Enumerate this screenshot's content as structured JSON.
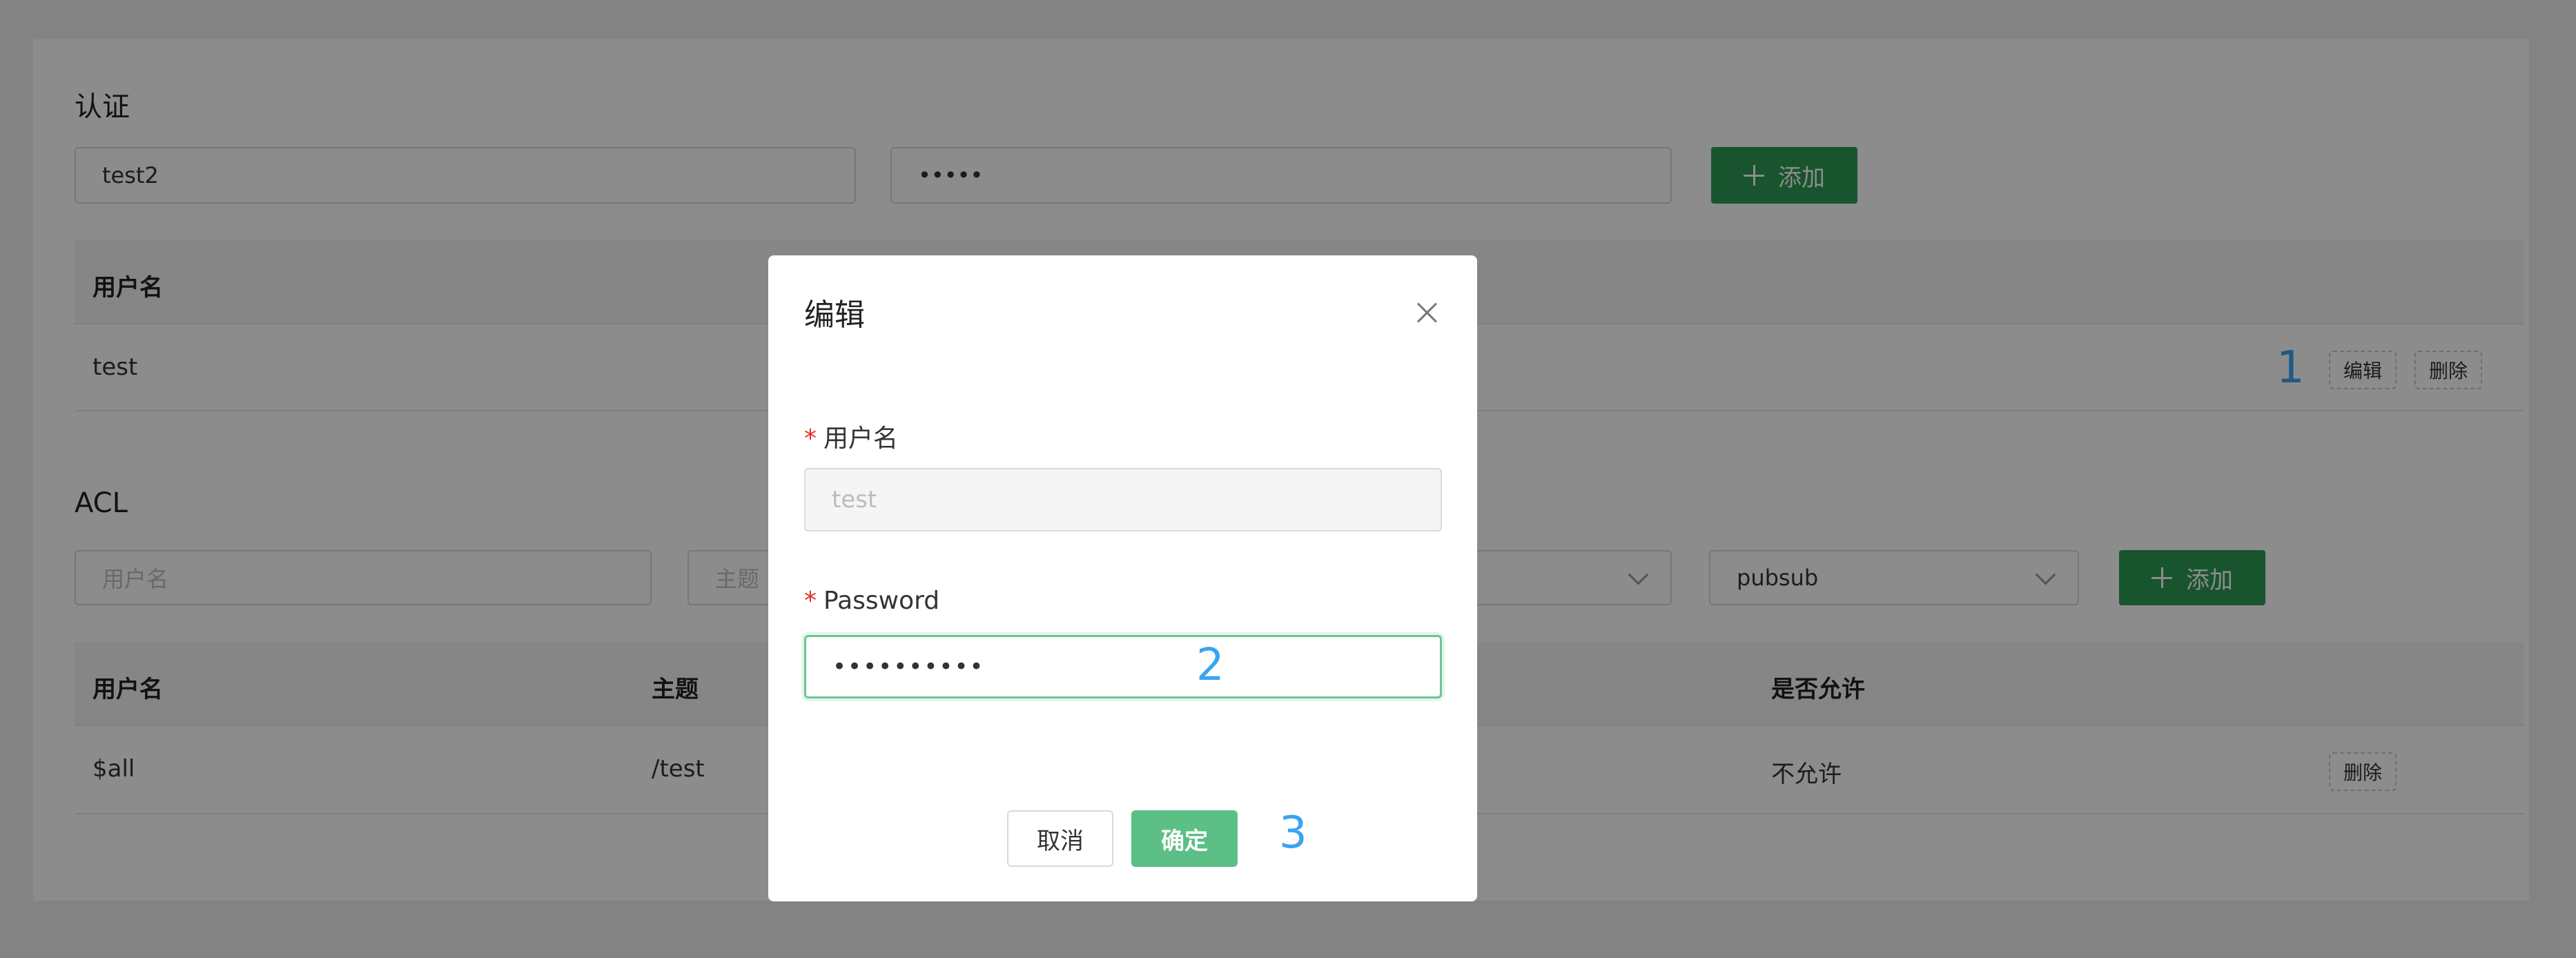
{
  "auth": {
    "title": "认证",
    "username_value": "test2",
    "password_value": "•••••",
    "add_label": "添加",
    "table": {
      "column_username": "用户名",
      "rows": [
        {
          "username": "test",
          "edit_label": "编辑",
          "delete_label": "删除"
        }
      ]
    }
  },
  "acl": {
    "title": "ACL",
    "username_placeholder": "用户名",
    "topic_placeholder": "主题",
    "action_selected": "pubsub",
    "add_label": "添加",
    "table": {
      "columns": [
        "用户名",
        "主题",
        "是否允许"
      ],
      "rows": [
        {
          "username": "$all",
          "topic": "/test",
          "allow": "不允许",
          "delete_label": "删除"
        }
      ]
    }
  },
  "modal": {
    "title": "编辑",
    "username_label": "用户名",
    "username_value": "test",
    "password_label": "Password",
    "password_value": "••••••••••",
    "cancel_label": "取消",
    "confirm_label": "确定"
  },
  "annotations": [
    "1",
    "2",
    "3"
  ],
  "colors": {
    "primary": "#2c9a55",
    "confirm": "#5cbf85",
    "annotation": "#3aa4f0",
    "required": "#e0302a"
  }
}
